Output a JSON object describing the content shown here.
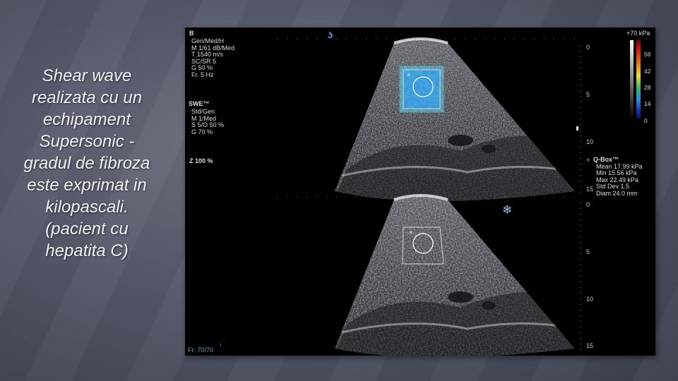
{
  "slide": {
    "caption_lines": [
      "Shear wave",
      "realizata cu un",
      "echipament",
      "Supersonic -",
      "gradul de fibroza",
      "este exprimat in",
      "kilopascali.",
      "(pacient cu",
      "hepatita C)"
    ]
  },
  "ultrasound": {
    "mode_label": "B",
    "b_mode_params": [
      "Gen/Med/H",
      "M 1/61 dB/Med",
      "T 1540 m/s",
      "SC/SR 5",
      "G 50 %",
      "Fr. 5 Hz"
    ],
    "swe_title": "SWE™",
    "swe_params": [
      "Std/Gen",
      "M 1/Med",
      "S 5/O 50 %",
      "G 70 %"
    ],
    "zoom_label": "Z 100 %",
    "frame_counter": "Fr: 70/70",
    "color_scale": {
      "title": "+70 kPa",
      "labels": [
        "56",
        "42",
        "28",
        "14",
        "0"
      ],
      "colors": [
        "#8a0a0a",
        "#e01010",
        "#f07a10",
        "#f0e020",
        "#30c060",
        "#2090e0",
        "#1030c0",
        "#0a0a60"
      ]
    },
    "qbox": {
      "title": "Q-Box™",
      "mean": "Mean 17.99 kPa",
      "min": "Min 15.56 kPa",
      "max": "Max 22.49 kPa",
      "std_dev": "Std Dev 1.5",
      "diam": "Diam 24.0 mm"
    },
    "depth_top": [
      "0",
      "5",
      "10",
      "15"
    ],
    "depth_bottom": [
      "0",
      "5",
      "10",
      "15"
    ],
    "icons": {
      "probe": "probe-orientation-icon",
      "freeze": "snowflake-freeze-icon",
      "qbox_marker": "x-marker-icon"
    }
  }
}
